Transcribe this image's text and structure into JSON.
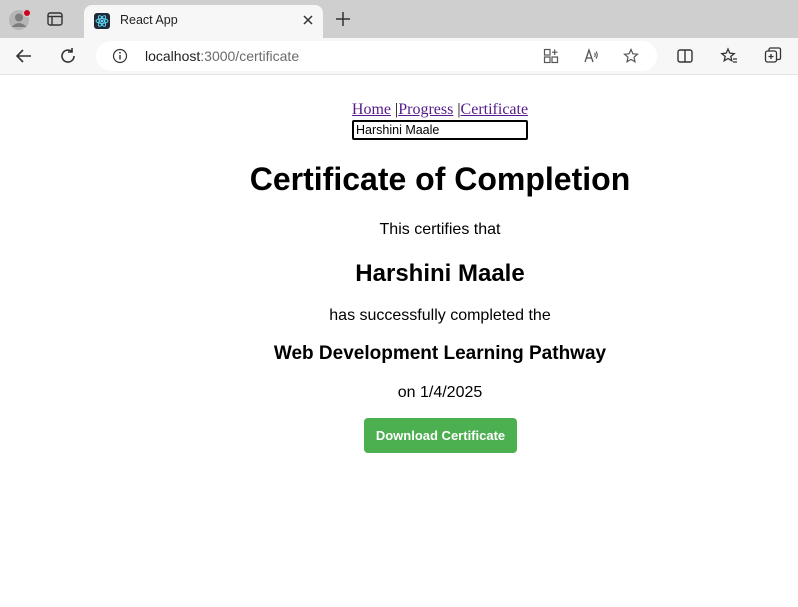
{
  "browser": {
    "tab_title": "React App",
    "url_host": "localhost",
    "url_path": ":3000/certificate",
    "icons": [
      "profile-icon",
      "tab-actions-icon",
      "react-favicon-icon",
      "close-icon",
      "plus-icon",
      "back-icon",
      "refresh-icon",
      "info-icon",
      "apps-icon",
      "read-aloud-icon",
      "star-icon",
      "split-screen-icon",
      "favorites-icon",
      "collections-icon"
    ]
  },
  "nav": {
    "home": "Home",
    "progress": "Progress",
    "certificate": "Certificate",
    "separator": " |"
  },
  "name_input": {
    "value": "Harshini Maale"
  },
  "certificate": {
    "title": "Certificate of Completion",
    "certifies": "This certifies that",
    "name": "Harshini Maale",
    "completed": "has successfully completed the",
    "pathway": "Web Development Learning Pathway",
    "date": "on 1/4/2025",
    "download_label": "Download Certificate"
  },
  "colors": {
    "button": "#4caf50",
    "link": "#551a8b"
  }
}
